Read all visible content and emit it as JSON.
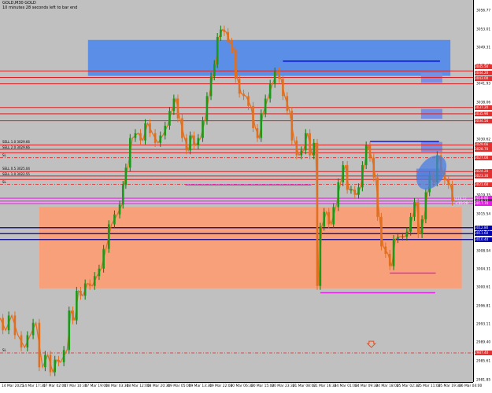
{
  "header": {
    "symbol": "GOLD,M30 GOLD",
    "countdown": "10 minutes 28 seconds left to bar end"
  },
  "chart_data": {
    "type": "candlestick",
    "symbol": "GOLD",
    "timeframe": "M30",
    "ylim": [
      2981.5,
      3059.0
    ],
    "y_ticks": [
      "3056.77",
      "3053.01",
      "3049.31",
      "3045.60",
      "3041.93",
      "3038.06",
      "3034.36",
      "3030.62",
      "3026.89",
      "3023.11",
      "3019.35",
      "3015.54",
      "3011.82",
      "3008.04",
      "3004.31",
      "3000.61",
      "2996.81",
      "2993.11",
      "2989.40",
      "2985.61",
      "2981.85"
    ],
    "x_ticks": [
      "14 Mar 2025",
      "14 Mar 17:30",
      "17 Mar 02:00",
      "17 Mar 10:30",
      "17 Mar 19:00",
      "18 Mar 03:30",
      "18 Mar 12:00",
      "18 Mar 20:30",
      "19 Mar 05:00",
      "19 Mar 13:30",
      "19 Mar 22:00",
      "20 Mar 06:30",
      "20 Mar 15:00",
      "20 Mar 23:30",
      "21 Mar 08:00",
      "21 Mar 16:30",
      "24 Mar 01:00",
      "24 Mar 09:30",
      "24 Mar 18:00",
      "25 Mar 02:30",
      "25 Mar 11:00",
      "25 Mar 19:30",
      "26 Mar 04:00"
    ],
    "current_price": 3018.12,
    "current_price_label": "3018.12",
    "timer_label": "<10:28",
    "zones": [
      {
        "color": "#5b8ee6",
        "y1": 3050.9,
        "y2": 3043.6,
        "x1": 0.186,
        "x2": 0.952
      },
      {
        "color": "#f7a07a",
        "y1": 3017.0,
        "y2": 3000.5,
        "x1": 0.083,
        "x2": 0.976
      }
    ],
    "small_zones": [
      {
        "color": "#7b8fe0",
        "y1": 3044.2,
        "y2": 3042.2,
        "x1": 0.89,
        "x2": 0.935
      },
      {
        "color": "#7b8fe0",
        "y1": 3036.9,
        "y2": 3034.9,
        "x1": 0.89,
        "x2": 0.935
      },
      {
        "color": "#7b8fe0",
        "y1": 3030.2,
        "y2": 3028.2,
        "x1": 0.89,
        "x2": 0.935
      },
      {
        "color": "#7b8fe0",
        "y1": 3024.8,
        "y2": 3022.5,
        "x1": 0.88,
        "x2": 0.935
      }
    ],
    "red_levels": [
      3044.6,
      3043.3,
      3042.0,
      3037.2,
      3035.9,
      3034.5,
      3029.6,
      3028.7,
      3028.0,
      3024.2,
      3023.3,
      3022.6
    ],
    "red_dashed_levels": [
      3027.0,
      3021.6,
      2987.4
    ],
    "red_level_labels": [
      {
        "y": 3029.9,
        "text": "SELL 1.0 3029.66"
      },
      {
        "y": 3028.9,
        "text": "SELL 2.0 3029.66"
      },
      {
        "y": 3027.3,
        "text": "SL"
      },
      {
        "y": 3024.5,
        "text": "SELL 0.5 3025.04"
      },
      {
        "y": 3023.4,
        "text": "SELL 1.0 3022.55"
      },
      {
        "y": 3021.8,
        "text": "SL"
      },
      {
        "y": 2987.7,
        "text": "SL"
      }
    ],
    "magenta_levels": [
      3018.8,
      3018.2,
      3017.7
    ],
    "navy_levels": [
      3012.8,
      3011.6,
      3010.4
    ],
    "ray_segments": [
      {
        "color": "#0000ff",
        "y": 3046.6,
        "x1": 0.598,
        "x2": 0.93
      },
      {
        "color": "#0000ff",
        "y": 3030.3,
        "x1": 0.782,
        "x2": 0.928
      },
      {
        "color": "#e020e0",
        "y": 3021.5,
        "x1": 0.392,
        "x2": 0.658
      },
      {
        "color": "#e020e0",
        "y": 3003.6,
        "x1": 0.824,
        "x2": 0.921
      },
      {
        "color": "#e020e0",
        "y": 2999.6,
        "x1": 0.677,
        "x2": 0.92
      }
    ],
    "axis_tags": [
      {
        "y": 3045.5,
        "text": "3045.50",
        "color": "#e03030"
      },
      {
        "y": 3044.2,
        "text": "3044.20",
        "color": "#e03030"
      },
      {
        "y": 3043.0,
        "text": "3043.00",
        "color": "#e03030"
      },
      {
        "y": 3037.2,
        "text": "3037.20",
        "color": "#e03030"
      },
      {
        "y": 3035.9,
        "text": "3035.90",
        "color": "#e03030"
      },
      {
        "y": 3034.5,
        "text": "3034.50",
        "color": "#e03030"
      },
      {
        "y": 3029.6,
        "text": "3029.66",
        "color": "#e03030"
      },
      {
        "y": 3028.7,
        "text": "3028.70",
        "color": "#e03030"
      },
      {
        "y": 3027.0,
        "text": "3027.00",
        "color": "#e03030"
      },
      {
        "y": 3024.2,
        "text": "3024.20",
        "color": "#e03030"
      },
      {
        "y": 3023.3,
        "text": "3023.30",
        "color": "#e03030"
      },
      {
        "y": 3021.6,
        "text": "3021.60",
        "color": "#e03030"
      },
      {
        "y": 3018.8,
        "text": "3018.80",
        "color": "#e020e0"
      },
      {
        "y": 3018.2,
        "text": "3018.12",
        "color": "#404040"
      },
      {
        "y": 3017.7,
        "text": "3017.70",
        "color": "#e020e0"
      },
      {
        "y": 3012.8,
        "text": "3012.80",
        "color": "#0000aa"
      },
      {
        "y": 3011.6,
        "text": "3011.60",
        "color": "#0000aa"
      },
      {
        "y": 3010.4,
        "text": "3010.40",
        "color": "#0000aa"
      },
      {
        "y": 2987.4,
        "text": "2987.40",
        "color": "#e03030"
      }
    ],
    "price_path": [
      [
        0.0,
        2994.5
      ],
      [
        0.012,
        2992.0
      ],
      [
        0.025,
        2995.0
      ],
      [
        0.038,
        2991.0
      ],
      [
        0.052,
        2988.5
      ],
      [
        0.064,
        2991.0
      ],
      [
        0.076,
        2993.5
      ],
      [
        0.09,
        2984.5
      ],
      [
        0.101,
        2987.0
      ],
      [
        0.112,
        2983.5
      ],
      [
        0.12,
        2986.0
      ],
      [
        0.128,
        2985.5
      ],
      [
        0.142,
        2988.0
      ],
      [
        0.15,
        2996.0
      ],
      [
        0.158,
        2994.0
      ],
      [
        0.166,
        3000.0
      ],
      [
        0.175,
        2999.0
      ],
      [
        0.185,
        3001.5
      ],
      [
        0.195,
        3001.0
      ],
      [
        0.205,
        3003.0
      ],
      [
        0.214,
        3004.5
      ],
      [
        0.224,
        3008.5
      ],
      [
        0.236,
        3013.5
      ],
      [
        0.248,
        3015.5
      ],
      [
        0.258,
        3017.5
      ],
      [
        0.262,
        3021.5
      ],
      [
        0.27,
        3025.0
      ],
      [
        0.28,
        3031.0
      ],
      [
        0.292,
        3032.0
      ],
      [
        0.302,
        3030.5
      ],
      [
        0.312,
        3034.0
      ],
      [
        0.322,
        3032.0
      ],
      [
        0.334,
        3030.0
      ],
      [
        0.344,
        3031.5
      ],
      [
        0.354,
        3033.5
      ],
      [
        0.363,
        3036.5
      ],
      [
        0.372,
        3039.0
      ],
      [
        0.38,
        3035.0
      ],
      [
        0.39,
        3031.0
      ],
      [
        0.398,
        3028.5
      ],
      [
        0.406,
        3031.5
      ],
      [
        0.414,
        3029.5
      ],
      [
        0.424,
        3031.0
      ],
      [
        0.433,
        3034.5
      ],
      [
        0.442,
        3039.5
      ],
      [
        0.45,
        3043.5
      ],
      [
        0.456,
        3046.0
      ],
      [
        0.463,
        3051.5
      ],
      [
        0.47,
        3053.0
      ],
      [
        0.478,
        3052.5
      ],
      [
        0.486,
        3050.5
      ],
      [
        0.494,
        3049.0
      ],
      [
        0.502,
        3043.0
      ],
      [
        0.51,
        3040.0
      ],
      [
        0.52,
        3039.5
      ],
      [
        0.53,
        3037.5
      ],
      [
        0.54,
        3033.0
      ],
      [
        0.548,
        3031.0
      ],
      [
        0.556,
        3036.0
      ],
      [
        0.566,
        3039.0
      ],
      [
        0.576,
        3042.0
      ],
      [
        0.586,
        3044.5
      ],
      [
        0.594,
        3043.0
      ],
      [
        0.602,
        3039.5
      ],
      [
        0.612,
        3036.5
      ],
      [
        0.622,
        3030.5
      ],
      [
        0.632,
        3027.5
      ],
      [
        0.642,
        3028.5
      ],
      [
        0.65,
        3032.0
      ],
      [
        0.66,
        3027.5
      ],
      [
        0.667,
        3030.0
      ],
      [
        0.674,
        3001.0
      ],
      [
        0.68,
        3013.0
      ],
      [
        0.69,
        3016.0
      ],
      [
        0.7,
        3013.5
      ],
      [
        0.71,
        3017.0
      ],
      [
        0.72,
        3022.0
      ],
      [
        0.73,
        3025.5
      ],
      [
        0.738,
        3020.5
      ],
      [
        0.746,
        3020.5
      ],
      [
        0.754,
        3019.5
      ],
      [
        0.762,
        3021.0
      ],
      [
        0.77,
        3025.5
      ],
      [
        0.778,
        3029.5
      ],
      [
        0.786,
        3027.0
      ],
      [
        0.794,
        3023.0
      ],
      [
        0.802,
        3015.0
      ],
      [
        0.81,
        3009.0
      ],
      [
        0.82,
        3007.5
      ],
      [
        0.828,
        3005.0
      ],
      [
        0.836,
        3010.5
      ],
      [
        0.846,
        3011.0
      ],
      [
        0.856,
        3011.0
      ],
      [
        0.864,
        3012.0
      ],
      [
        0.872,
        3015.0
      ],
      [
        0.88,
        3018.0
      ],
      [
        0.888,
        3011.5
      ],
      [
        0.896,
        3014.5
      ],
      [
        0.904,
        3020.0
      ],
      [
        0.912,
        3023.5
      ],
      [
        0.92,
        3022.0
      ],
      [
        0.928,
        3027.5
      ],
      [
        0.936,
        3024.0
      ],
      [
        0.944,
        3022.5
      ],
      [
        0.952,
        3021.5
      ],
      [
        0.96,
        3018.1
      ]
    ]
  }
}
